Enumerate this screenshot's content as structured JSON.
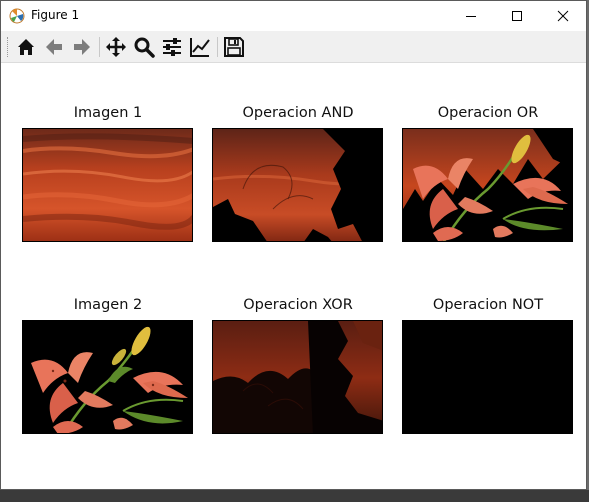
{
  "window": {
    "title": "Figure 1"
  },
  "toolbar": {
    "buttons": [
      {
        "icon": "home-icon"
      },
      {
        "icon": "back-arrow-icon"
      },
      {
        "icon": "forward-arrow-icon"
      },
      {
        "icon": "pan-move-icon"
      },
      {
        "icon": "zoom-magnifier-icon"
      },
      {
        "icon": "configure-subplots-icon"
      },
      {
        "icon": "edit-axis-icon"
      },
      {
        "icon": "save-floppy-icon"
      }
    ]
  },
  "subplots": [
    {
      "title": "Imagen 1"
    },
    {
      "title": "Operacion AND"
    },
    {
      "title": "Operacion OR"
    },
    {
      "title": "Imagen 2"
    },
    {
      "title": "Operacion XOR"
    },
    {
      "title": "Operacion NOT"
    }
  ],
  "colors": {
    "sunset_dark": "#7a1e0e",
    "sunset_mid": "#c4401c",
    "sunset_light": "#e0663a",
    "lily_petal": "#e8745a",
    "lily_bud": "#d9b43a",
    "stem": "#5c8a2a",
    "background_black": "#000000"
  }
}
